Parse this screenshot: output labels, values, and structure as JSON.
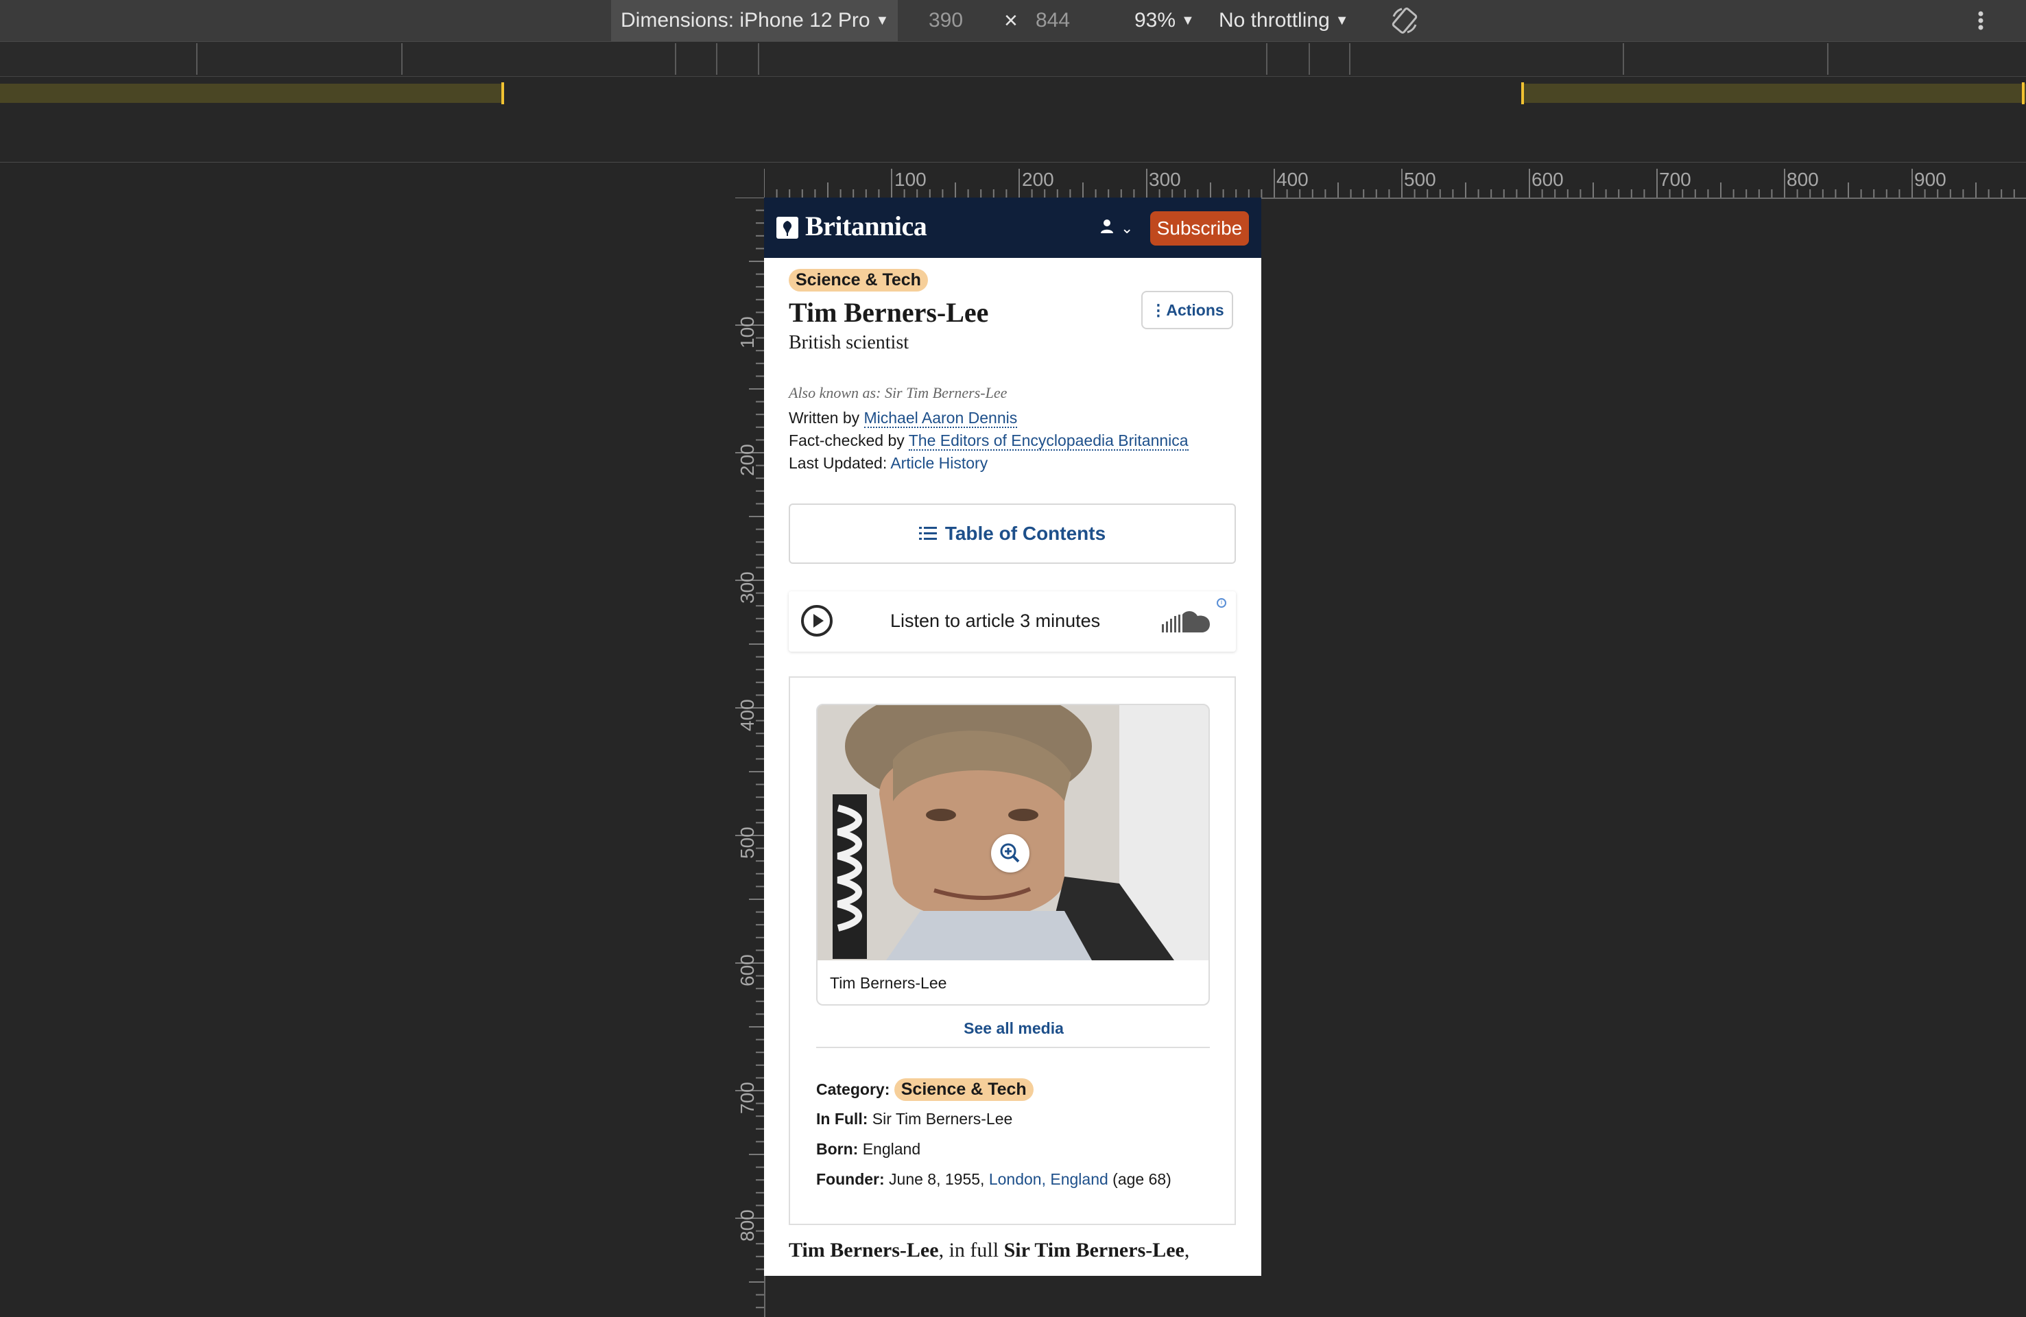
{
  "devtools": {
    "dimensions_label": "Dimensions: iPhone 12 Pro",
    "width_value": "390",
    "times": "×",
    "height_value": "844",
    "zoom_label": "93%",
    "throttling_label": "No throttling",
    "rotate_icon": "rotate-icon",
    "more_icon": "more-vertical-icon",
    "ruler_h_labels": [
      "100",
      "200",
      "300",
      "400",
      "500",
      "600",
      "700",
      "800",
      "900"
    ],
    "ruler_v_labels": [
      "100",
      "200",
      "300",
      "400",
      "500",
      "600",
      "700",
      "800"
    ]
  },
  "header": {
    "logo_text": "Britannica",
    "subscribe_label": "Subscribe",
    "brand_color": "#0f1f3a",
    "accent_color": "#c0491e"
  },
  "article": {
    "category_tag": "Science & Tech",
    "title": "Tim Berners-Lee",
    "subtitle": "British scientist",
    "actions_label": "Actions",
    "also_known_as": "Also known as: Sir Tim Berners-Lee",
    "written_by_label": "Written by",
    "written_by": "Michael Aaron Dennis",
    "fact_checked_label": "Fact-checked by",
    "fact_checked_by": "The Editors of Encyclopaedia Britannica",
    "last_updated_label": "Last Updated:",
    "article_history": "Article History",
    "toc_label": "Table of Contents",
    "listen_label": "Listen to article 3 minutes",
    "info_icon": "i",
    "photo_caption": "Tim Berners-Lee",
    "see_all_media": "See all media",
    "facts": {
      "category_label": "Category:",
      "category_value": "Science & Tech",
      "in_full_label": "In Full:",
      "in_full_value": "Sir Tim Berners-Lee",
      "born_label": "Born:",
      "born_value": "England",
      "founder_label": "Founder:",
      "founder_date": "June 8, 1955,",
      "founder_place": "London, England",
      "founder_age": "(age 68)"
    },
    "lead_name": "Tim Berners-Lee",
    "lead_mid": ", in full ",
    "lead_fullname": "Sir Tim Berners-Lee",
    "lead_end": ","
  }
}
